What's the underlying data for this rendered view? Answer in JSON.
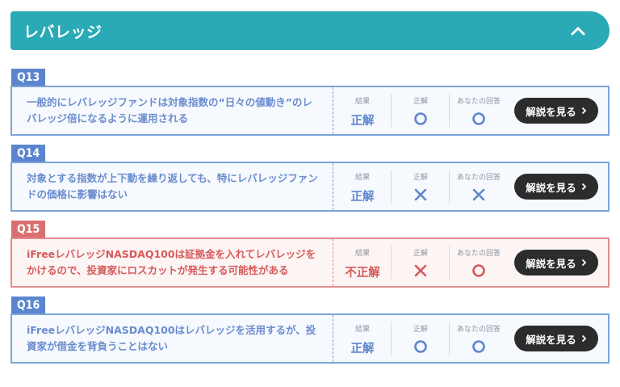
{
  "section": {
    "title": "レバレッジ"
  },
  "columns": {
    "result": "結果",
    "correct": "正解",
    "your_answer": "あなたの回答"
  },
  "button_label": "解説を見る",
  "colors": {
    "teal": "#2aa9b6",
    "blue": "#7ba4d9",
    "red": "#e28a8a"
  },
  "questions": [
    {
      "badge": "Q13",
      "text": "一般的にレバレッジファンドは対象指数の“日々の値動き”のレバレッジ倍になるように運用される",
      "result": "正解",
      "correct": "circle",
      "answer": "circle",
      "status": "right"
    },
    {
      "badge": "Q14",
      "text": "対象とする指数が上下動を繰り返しても、特にレバレッジファンドの価格に影響はない",
      "result": "正解",
      "correct": "cross",
      "answer": "cross",
      "status": "right"
    },
    {
      "badge": "Q15",
      "text": "iFreeレバレッジNASDAQ100は証拠金を入れてレバレッジをかけるので、投資家にロスカットが発生する可能性がある",
      "result": "不正解",
      "correct": "cross",
      "answer": "circle",
      "status": "wrong"
    },
    {
      "badge": "Q16",
      "text": "iFreeレバレッジNASDAQ100はレバレッジを活用するが、投資家が借金を背負うことはない",
      "result": "正解",
      "correct": "circle",
      "answer": "circle",
      "status": "right"
    }
  ]
}
